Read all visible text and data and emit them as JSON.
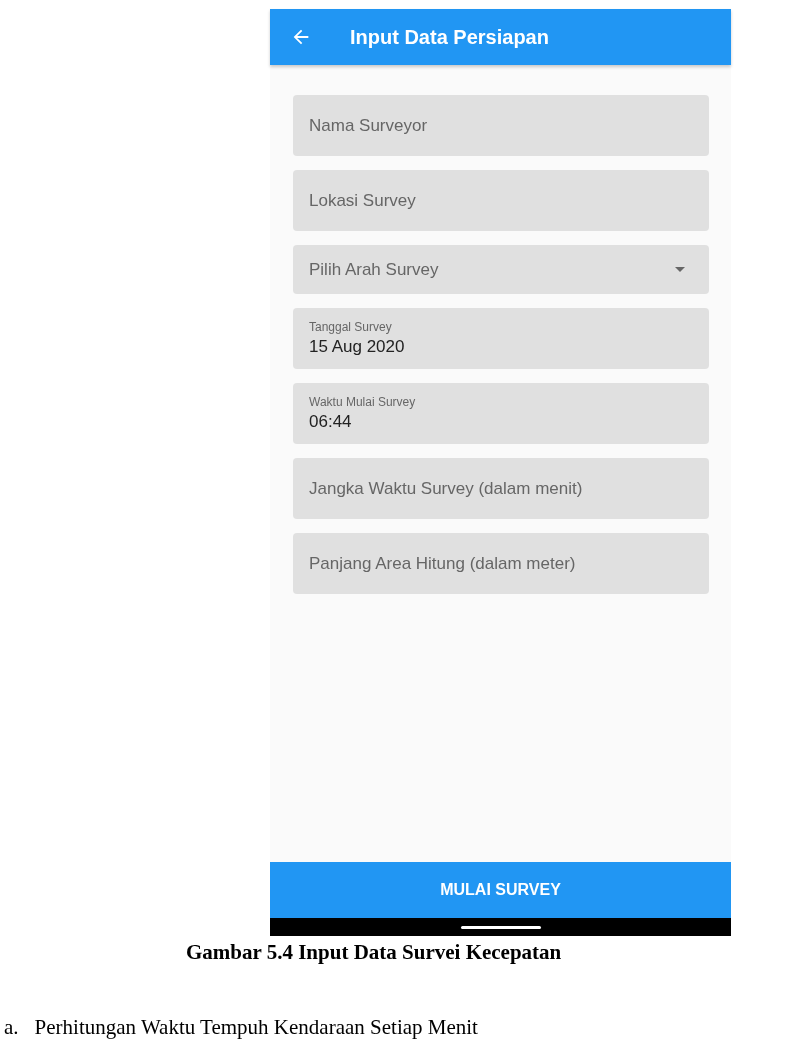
{
  "app_bar": {
    "title": "Input Data Persiapan"
  },
  "fields": [
    {
      "kind": "text",
      "placeholder": "Nama Surveyor"
    },
    {
      "kind": "text",
      "placeholder": "Lokasi Survey"
    },
    {
      "kind": "select",
      "placeholder": "Pilih Arah Survey"
    },
    {
      "kind": "filled",
      "label": "Tanggal Survey",
      "value": "15 Aug 2020"
    },
    {
      "kind": "filled",
      "label": "Waktu Mulai Survey",
      "value": "06:44"
    },
    {
      "kind": "text",
      "placeholder": "Jangka Waktu Survey (dalam menit)"
    },
    {
      "kind": "text",
      "placeholder": "Panjang Area Hitung (dalam meter)"
    }
  ],
  "primary_button": "MULAI SURVEY",
  "caption": "Gambar 5.4 Input Data Survei Kecepatan",
  "next_section": {
    "marker": "a.",
    "heading": "Perhitungan Waktu Tempuh Kendaraan Setiap Menit"
  }
}
